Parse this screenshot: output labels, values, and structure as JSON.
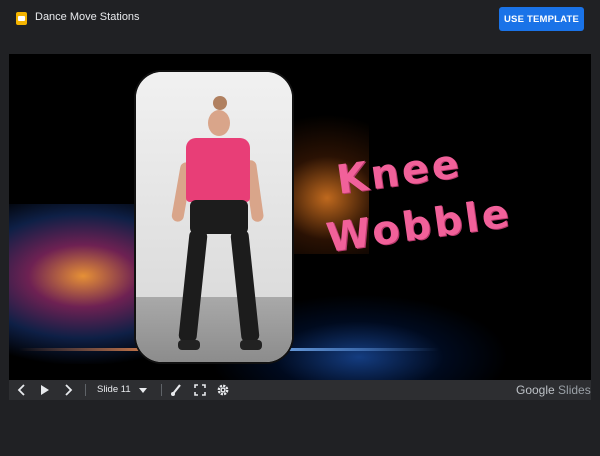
{
  "header": {
    "title": "Dance Move Stations",
    "use_template_label": "USE TEMPLATE",
    "title_icon": "slides-icon",
    "accent_color": "#1a73e8"
  },
  "slide": {
    "title_line1": "Knee",
    "title_line2": "Wobble",
    "title_color": "#f1619a",
    "photo": "woman-dancing-photo"
  },
  "controls": {
    "prev_icon": "chevron-left-icon",
    "play_icon": "play-icon",
    "next_icon": "chevron-right-icon",
    "slide_label": "Slide 11",
    "dropdown_icon": "caret-down-icon",
    "laser_icon": "laser-pointer-icon",
    "fullscreen_icon": "fullscreen-icon",
    "settings_icon": "gear-icon",
    "brand_primary": "Google",
    "brand_secondary": "Slides"
  }
}
